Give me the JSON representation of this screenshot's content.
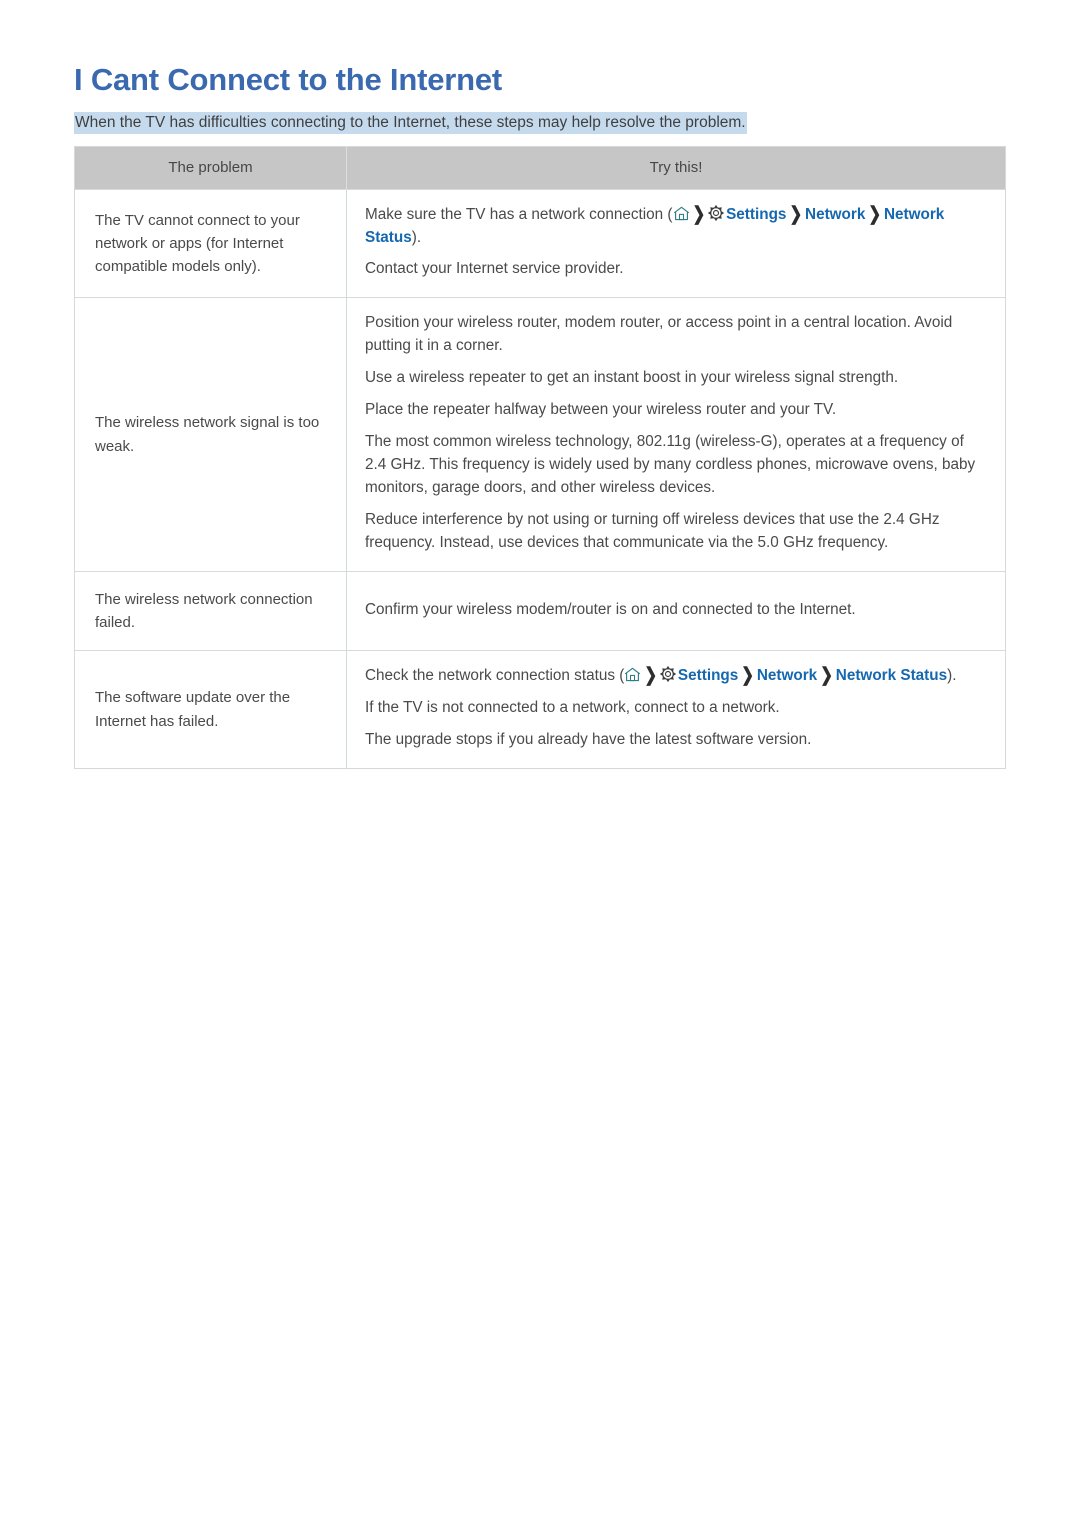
{
  "page": {
    "title": "I Cant Connect to the Internet",
    "subtitle": "When the TV has difficulties connecting to the Internet, these steps may help resolve the problem."
  },
  "colors": {
    "title_blue": "#3a69b0",
    "link_blue": "#1568b0",
    "highlight_bg": "#c6daee",
    "header_bg": "#c6c6c6",
    "body_text": "#4a4a4a",
    "home_icon": "#2e7d86",
    "gear_icon": "#3c3c3c"
  },
  "table": {
    "headers": {
      "problem": "The problem",
      "try_this": "Try this!"
    },
    "rows": [
      {
        "problem": "The TV cannot connect to your network or apps (for Internet compatible models only).",
        "items": [
          {
            "type": "path",
            "prefix": "Make sure the TV has a network connection (",
            "home_icon": "home-icon",
            "gear_icon": "gear-icon",
            "links": [
              "Settings",
              "Network",
              "Network Status"
            ],
            "suffix": ")."
          },
          {
            "type": "text",
            "text": "Contact your Internet service provider."
          }
        ]
      },
      {
        "problem": "The wireless network signal is too weak.",
        "items": [
          {
            "type": "text",
            "text": "Position your wireless router, modem router, or access point in a central location. Avoid putting it in a corner."
          },
          {
            "type": "text",
            "text": "Use a wireless repeater to get an instant boost in your wireless signal strength."
          },
          {
            "type": "text",
            "text": "Place the repeater halfway between your wireless router and your TV."
          },
          {
            "type": "text",
            "text": "The most common wireless technology, 802.11g (wireless-G), operates at a frequency of 2.4 GHz. This frequency is widely used by many cordless phones, microwave ovens, baby monitors, garage doors, and other wireless devices."
          },
          {
            "type": "text",
            "text": "Reduce interference by not using or turning off wireless devices that use the 2.4 GHz frequency. Instead, use devices that communicate via the 5.0 GHz frequency."
          }
        ]
      },
      {
        "problem": "The wireless network connection failed.",
        "items": [
          {
            "type": "text",
            "text": "Confirm your wireless modem/router is on and connected to the Internet."
          }
        ]
      },
      {
        "problem": "The software update over the Internet has failed.",
        "items": [
          {
            "type": "path",
            "prefix": "Check the network connection status (",
            "home_icon": "home-icon",
            "gear_icon": "gear-icon",
            "links": [
              "Settings",
              "Network",
              "Network Status"
            ],
            "suffix": ")."
          },
          {
            "type": "text",
            "text": "If the TV is not connected to a network, connect to a network."
          },
          {
            "type": "text",
            "text": "The upgrade stops if you already have the latest software version."
          }
        ]
      }
    ]
  }
}
